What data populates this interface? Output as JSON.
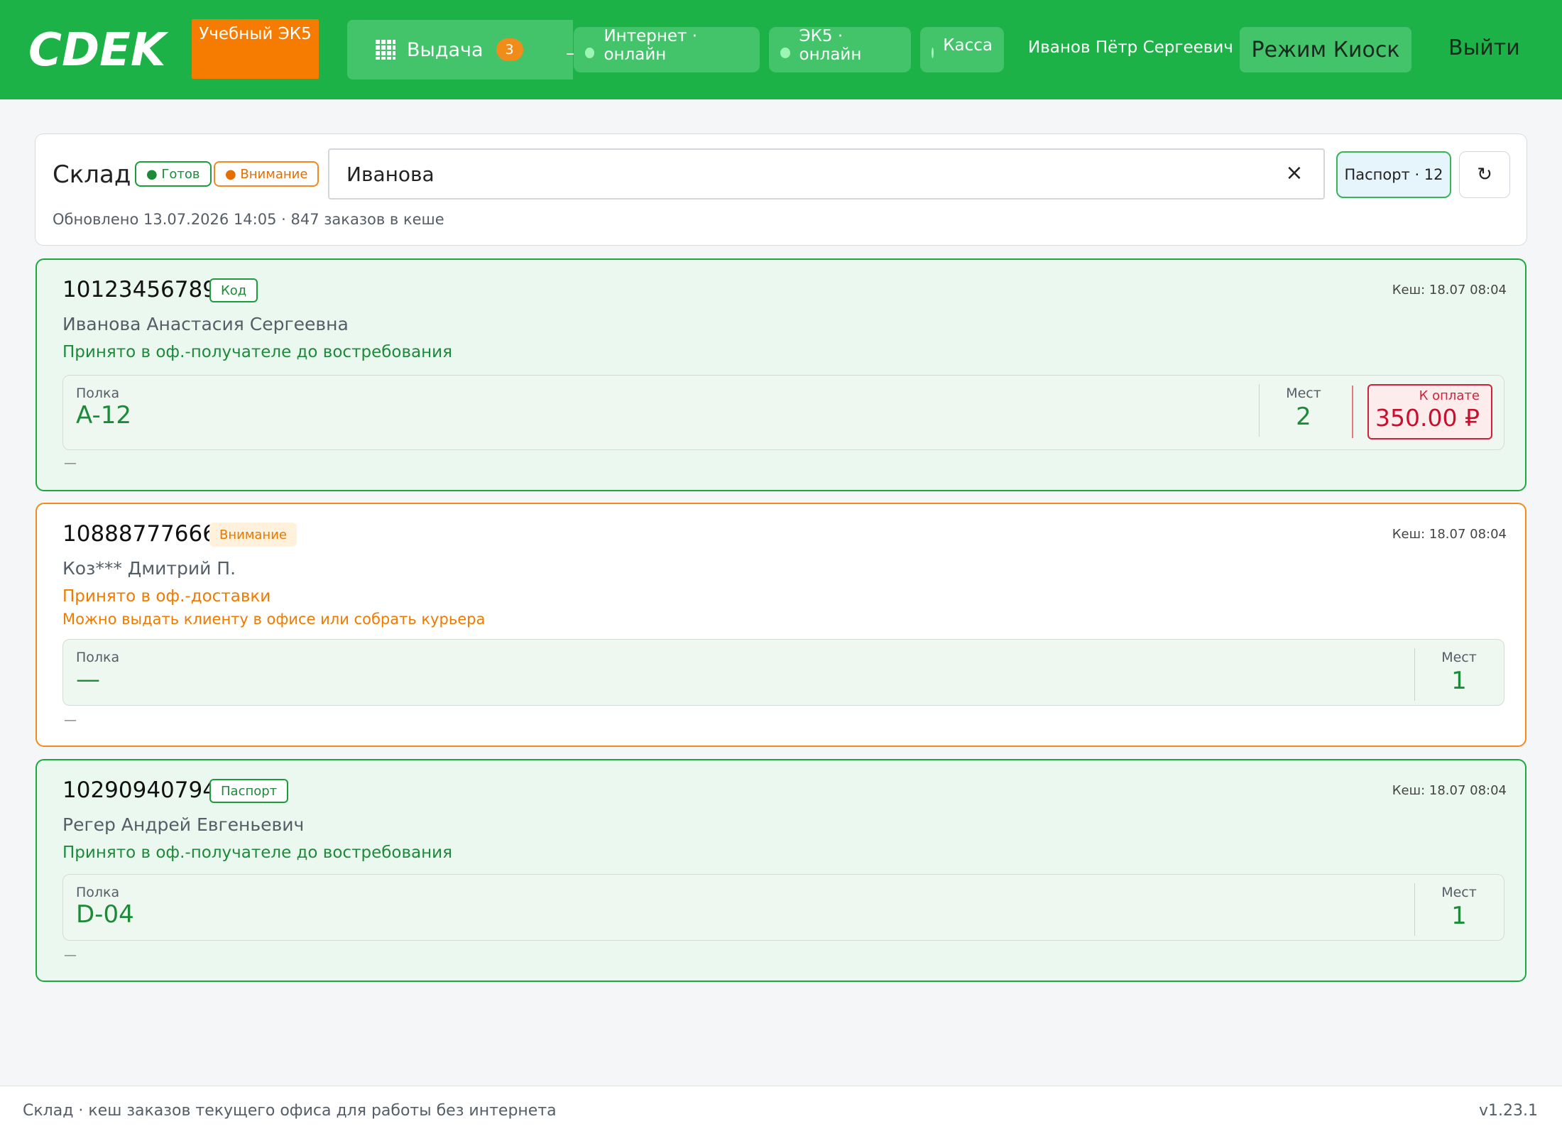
{
  "header": {
    "logo_text": "CDEK",
    "training_label": "Учебный ЭК5",
    "issue_tab": {
      "label": "Выдача",
      "count": "3",
      "trail": "–"
    },
    "statuses": [
      {
        "label": "Интернет · онлайн"
      },
      {
        "label": "ЭК5 · онлайн"
      },
      {
        "label": "Касса"
      }
    ],
    "user_name": "Иванов Пётр Сергеевич",
    "kiosk_label": "Режим Киоск",
    "logout_label": "Выйти",
    "accent": "#1db248"
  },
  "warehouse": {
    "title": "Склад",
    "badge_ready": "● Готов",
    "badge_warn": "● Внимание",
    "search_value": "Иванова",
    "passport_label": "Паспорт · 12",
    "refresh_icon": "↻",
    "updated_text": "Обновлено 13.07.2026 14:05 · 847 заказов в кеше"
  },
  "orders": [
    {
      "number": "10123456789",
      "tag": "Код",
      "cache": "Кеш: 18.07 08:04",
      "person": "Иванова Анастасия Сергеевна",
      "status": "Принято в оф.-получателе до востребования",
      "shelf_label": "Полка",
      "shelf": "A-12",
      "places_label": "Мест",
      "places": "2",
      "pay_label": "К оплате",
      "pay": "350.00 ₽",
      "footer": "—"
    },
    {
      "number": "10888777666",
      "tag": "Внимание",
      "cache": "Кеш: 18.07 08:04",
      "person": "Коз*** Дмитрий П.",
      "status": "Принято в оф.-доставки",
      "status2": "Можно выдать клиенту в офисе или собрать курьера",
      "shelf_label": "Полка",
      "shelf": "—",
      "places_label": "Мест",
      "places": "1",
      "footer": "—"
    },
    {
      "number": "10290940794",
      "tag": "Паспорт",
      "cache": "Кеш: 18.07 08:04",
      "person": "Регер Андрей Евгеньевич",
      "status": "Принято в оф.-получателе до востребования",
      "shelf_label": "Полка",
      "shelf": "D-04",
      "places_label": "Мест",
      "places": "1",
      "footer": "—"
    }
  ],
  "footer": {
    "left": "Склад · кеш заказов текущего офиса для работы без интернета",
    "right": "v1.23.1"
  }
}
